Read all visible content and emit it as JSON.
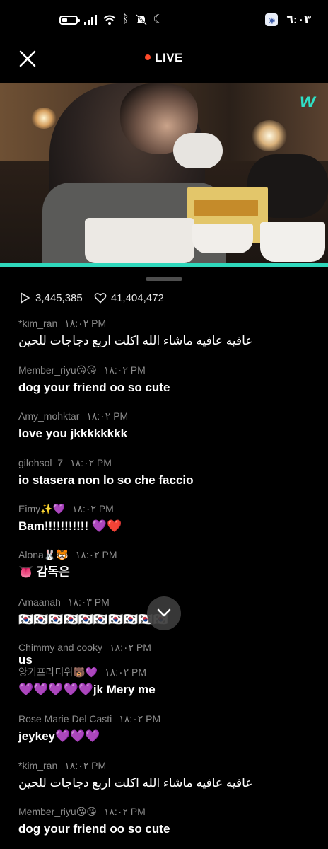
{
  "status_bar": {
    "time": "٦:٠٣",
    "icons": [
      "battery-icon",
      "signal-icon",
      "wifi-icon",
      "bluetooth-icon",
      "mute-icon",
      "moon-icon",
      "app-badge-icon"
    ]
  },
  "header": {
    "live_label": "LIVE",
    "live_dot_color": "#ff4a2a"
  },
  "video": {
    "brand_mark": "w",
    "accent_color": "#2fd8bc"
  },
  "stats": {
    "plays": "3,445,385",
    "likes": "41,404,472"
  },
  "chat": {
    "messages": [
      {
        "user": "*kim_ran",
        "time": "١٨:٠٢ PM",
        "text": "عافيه عافيه ماشاء الله اكلت اربع دجاجات للحين"
      },
      {
        "user": "Member_riyu😘😘",
        "time": "١٨:٠٢ PM",
        "text": "dog your  friend  oo so cute"
      },
      {
        "user": "Amy_mohktar",
        "time": "١٨:٠٢ PM",
        "text": "love you jkkkkkkkk"
      },
      {
        "user": "gilohsol_7",
        "time": "١٨:٠٢ PM",
        "text": "io stasera non lo so che faccio"
      },
      {
        "user": "Eimy✨💜",
        "time": "١٨:٠٢ PM",
        "text": "Bam!!!!!!!!!!! 💜❤️"
      },
      {
        "user": "Alona🐰🐯",
        "time": "١٨:٠٢ PM",
        "text": "👅 감독은"
      },
      {
        "user": "Amaanah",
        "time": "١٨:٠٣ PM",
        "text": "🇰🇷🇰🇷🇰🇷🇰🇷🇰🇷🇰🇷🇰🇷🇰🇷🇰🇷🇰🇷"
      },
      {
        "user": "Chimmy and cooky",
        "time": "١٨:٠٢ PM",
        "text": "us"
      },
      {
        "user": "양기프라티위🐻💜",
        "time": "١٨:٠٢ PM",
        "text": "💜💜💜💜💜jk Mery me"
      },
      {
        "user": "Rose Marie Del Casti",
        "time": "١٨:٠٢ PM",
        "text": "jeykey💜💜💜"
      },
      {
        "user": "*kim_ran",
        "time": "١٨:٠٢ PM",
        "text": "عافيه عافيه ماشاء الله اكلت اربع دجاجات للحين"
      },
      {
        "user": "Member_riyu😘😘",
        "time": "١٨:٠٢ PM",
        "text": "dog your  friend  oo so cute"
      }
    ]
  }
}
